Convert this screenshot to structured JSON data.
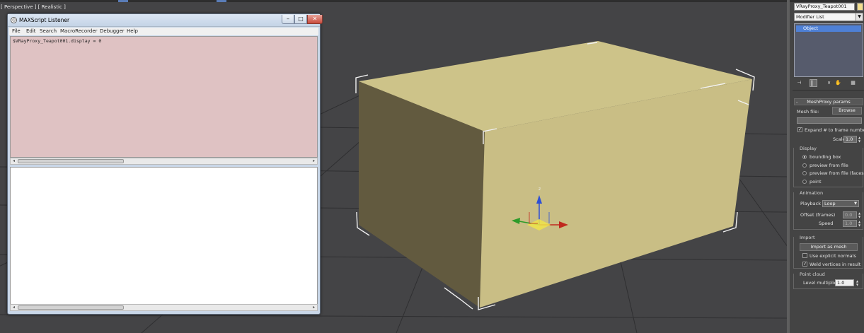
{
  "viewport": {
    "label": "[ Perspective ] [ Realistic ]",
    "gizmo_axis_label": "z",
    "bg_color": "#444446",
    "box_colors": {
      "top": "#cdc389",
      "front": "#c9be85",
      "side": "#625a3f"
    }
  },
  "listener": {
    "title": "MAXScript Listener",
    "app_icon": "maxscript-icon",
    "window_buttons": {
      "minimize": "–",
      "maximize": "□",
      "close": "✕"
    },
    "menu": [
      "File",
      "Edit",
      "Search",
      "MacroRecorder",
      "Debugger",
      "Help"
    ],
    "macro_text": "$VRayProxy_Teapot001.display = 0",
    "output_text": "",
    "macro_bg": "#dfc2c3"
  },
  "panel": {
    "object_name": "VRayProxy_Teapot001",
    "object_color": "#f2de8e",
    "modifier_list": "Modifier List",
    "stack_item": "Object",
    "rollout_title": "MeshProxy params",
    "mesh_file_label": "Mesh file:",
    "browse_label": "Browse",
    "mesh_file_value": "",
    "expand_label": "Expand # to frame number",
    "scale_label": "Scale:",
    "scale_value": "1.0",
    "display": {
      "title": "Display",
      "options": [
        "bounding box",
        "preview from file",
        "preview from file (faces)",
        "point"
      ],
      "selected": "bounding box"
    },
    "animation": {
      "title": "Animation",
      "playback_label": "Playback",
      "playback_value": "Loop",
      "offset_label": "Offset (frames)",
      "offset_value": "0.0",
      "speed_label": "Speed",
      "speed_value": "1.0"
    },
    "import": {
      "title": "Import",
      "button": "Import as mesh",
      "explicit_normals_label": "Use explicit normals",
      "weld_label": "Weld vertices in result"
    },
    "point_cloud": {
      "title": "Point cloud",
      "level_label": "Level multiplier",
      "level_value": "1.0"
    }
  }
}
